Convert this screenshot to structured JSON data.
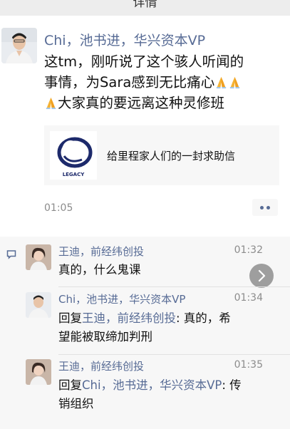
{
  "topbar": {
    "title": "详情"
  },
  "post": {
    "author": "Chi，池书进，华兴资本VP",
    "text_line1": "这tm，刚听说了这个骇人听闻的",
    "text_line2": "事情，为Sara感到无比痛心",
    "text_line3": "大家真的要远离这种灵修班",
    "emoji": "folded-hands-icon",
    "link_title": "给里程家人们的一封求助信",
    "link_logo_text": "LEGACY",
    "time": "01:05"
  },
  "comments": [
    {
      "name": "王迪，前经纬创投",
      "time": "01:32",
      "text": "真的，什么鬼课"
    },
    {
      "name": "Chi，池书进，华兴资本VP",
      "time": "01:34",
      "reply_prefix": "回复",
      "reply_to": "王迪，前经纬创投",
      "text_line1": ": 真的，希",
      "text_line2": "望能被取缔加判刑"
    },
    {
      "name": "王迪，前经纬创投",
      "time": "01:35",
      "reply_prefix": "回复",
      "reply_to": "Chi，池书进，华兴资本VP",
      "text_line1": ": 传",
      "text_line2": "销组织"
    }
  ],
  "colors": {
    "link_blue": "#576b95",
    "comment_bg": "#f7f7f7",
    "time_gray": "#8c8c8c"
  }
}
